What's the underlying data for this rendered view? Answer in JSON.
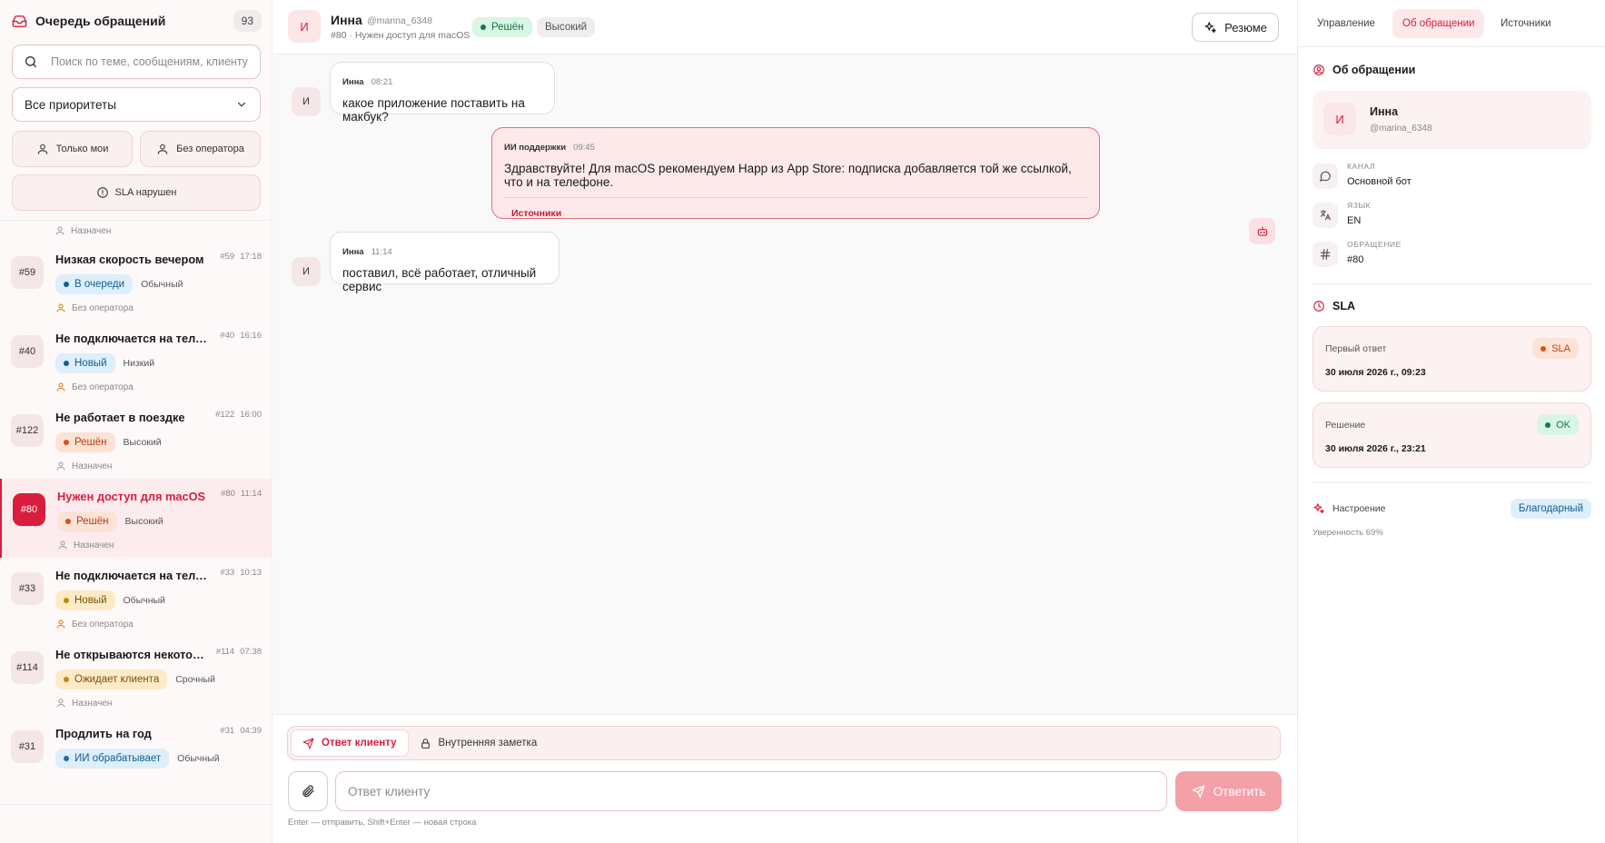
{
  "colors": {
    "accent": "#d81e3c",
    "accent_light": "#fde8ea",
    "send_disabled": "#f3a0a9"
  },
  "sidebar": {
    "title": "Очередь обращений",
    "count": "93",
    "search_placeholder": "Поиск по теме, сообщениям, клиенту и...",
    "priority_filter": "Все приоритеты",
    "filter_mine": "Только мои",
    "filter_no_operator": "Без оператора",
    "filter_sla": "SLA нарушен",
    "prev_tail": "Назначен",
    "tickets": [
      {
        "num": "#59",
        "title": "Низкая скорость вечером",
        "id": "#59",
        "time": "17:18",
        "status": "В очереди",
        "status_style": "b-queue",
        "priority": "Обычный",
        "assign": "Без оператора"
      },
      {
        "num": "#40",
        "title": "Не подключается на телефоне",
        "id": "#40",
        "time": "16:16",
        "status": "Новый",
        "status_style": "b-new",
        "priority": "Низкий",
        "assign": "Без оператора"
      },
      {
        "num": "#122",
        "title": "Не работает в поездке",
        "id": "#122",
        "time": "16:00",
        "status": "Решён",
        "status_style": "b-solved",
        "priority": "Высокий",
        "assign": "Назначен"
      },
      {
        "num": "#80",
        "title": "Нужен доступ для macOS",
        "id": "#80",
        "time": "11:14",
        "status": "Решён",
        "status_style": "b-solved",
        "priority": "Высокий",
        "assign": "Назначен"
      },
      {
        "num": "#33",
        "title": "Не подключается на телефоне",
        "id": "#33",
        "time": "10:13",
        "status": "Новый",
        "status_style": "b-newy",
        "priority": "Обычный",
        "assign": "Без оператора"
      },
      {
        "num": "#114",
        "title": "Не открываются некоторые сайты",
        "id": "#114",
        "time": "07:38",
        "status": "Ожидает клиента",
        "status_style": "b-wait",
        "priority": "Срочный",
        "assign": "Назначен"
      },
      {
        "num": "#31",
        "title": "Продлить на год",
        "id": "#31",
        "time": "04:39",
        "status": "ИИ обрабатывает",
        "status_style": "b-ai",
        "priority": "Обычный",
        "assign": ""
      }
    ]
  },
  "header": {
    "avatar": "И",
    "name": "Инна",
    "handle": "@marina_6348",
    "subtitle": "#80 · Нужен доступ для macOS",
    "status": "Решён",
    "priority": "Высокий",
    "resume_label": "Резюме"
  },
  "messages": [
    {
      "avatar": "И",
      "author": "Инна",
      "time": "08:21",
      "text": "какое приложение поставить на макбук?"
    },
    {
      "author": "ИИ поддержки",
      "time": "09:45",
      "text": "Здравствуйте! Для macOS рекомендуем Happ из App Store: подписка добавляется той же ссылкой, что и на телефоне.",
      "sources": "Источники"
    },
    {
      "avatar": "И",
      "author": "Инна",
      "time": "11:14",
      "text": "поставил, всё работает, отличный сервис"
    }
  ],
  "composer": {
    "tab_reply": "Ответ клиенту",
    "tab_note": "Внутренняя заметка",
    "placeholder": "Ответ клиенту",
    "send_label": "Ответить",
    "hint": "Enter — отправить, Shift+Enter — новая строка"
  },
  "right": {
    "tabs": [
      "Управление",
      "Об обращении",
      "Источники"
    ],
    "section_about": "Об обращении",
    "client_avatar": "И",
    "client_name": "Инна",
    "client_handle": "@marina_6348",
    "channel_label": "КАНАЛ",
    "channel_value": "Основной бот",
    "lang_label": "ЯЗЫК",
    "lang_value": "EN",
    "ticket_label": "ОБРАЩЕНИЕ",
    "ticket_value": "#80",
    "section_sla": "SLA",
    "sla_first_label": "Первый ответ",
    "sla_first_date": "30 июля 2026 г., 09:23",
    "sla_first_chip": "SLA",
    "sla_resolve_label": "Решение",
    "sla_resolve_date": "30 июля 2026 г., 23:21",
    "sla_resolve_chip": "OK",
    "mood_label": "Настроение",
    "mood_value": "Благодарный",
    "confidence": "Уверенность 69%"
  }
}
